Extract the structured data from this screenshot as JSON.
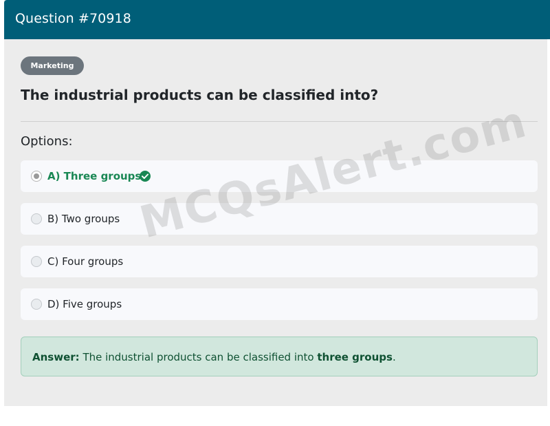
{
  "header": {
    "title": "Question #70918"
  },
  "category": "Marketing",
  "question": "The industrial products can be classified into?",
  "options_label": "Options:",
  "options": [
    {
      "text": "A) Three groups",
      "selected": true,
      "correct": true
    },
    {
      "text": "B) Two groups",
      "selected": false,
      "correct": false
    },
    {
      "text": "C) Four groups",
      "selected": false,
      "correct": false
    },
    {
      "text": "D) Five groups",
      "selected": false,
      "correct": false
    }
  ],
  "answer": {
    "label": "Answer:",
    "text": "The industrial products can be classified into",
    "highlight": "three groups",
    "suffix": "."
  },
  "watermark": "MCQsAlert.com",
  "colors": {
    "header": "#005e78",
    "correct": "#198754",
    "answer_bg": "#d1e7dd",
    "badge": "#6c757d"
  }
}
